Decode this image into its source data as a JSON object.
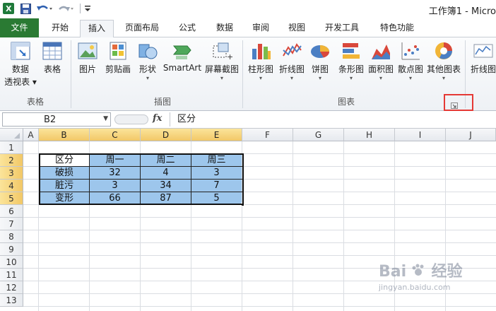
{
  "window": {
    "title": "工作簿1 - Micro"
  },
  "tabs": [
    "文件",
    "开始",
    "插入",
    "页面布局",
    "公式",
    "数据",
    "审阅",
    "视图",
    "开发工具",
    "特色功能"
  ],
  "ribbon": {
    "groups": {
      "tables": "表格",
      "illustrations": "插图",
      "charts": "图表"
    },
    "buttons": {
      "pivot_line1": "数据",
      "pivot_line2": "透视表",
      "table": "表格",
      "picture": "图片",
      "clipart": "剪贴画",
      "shapes": "形状",
      "smartart": "SmartArt",
      "screenshot": "屏幕截图",
      "column": "柱形图",
      "line": "折线图",
      "pie": "饼图",
      "bar": "条形图",
      "area": "面积图",
      "scatter": "散点图",
      "other": "其他图表",
      "sparkline": "折线图"
    }
  },
  "formula_bar": {
    "name_box": "B2",
    "fx": "fx",
    "value": "区分"
  },
  "columns": [
    "A",
    "B",
    "C",
    "D",
    "E",
    "F",
    "G",
    "H",
    "I",
    "J"
  ],
  "rows": [
    "1",
    "2",
    "3",
    "4",
    "5",
    "6",
    "7",
    "8",
    "9",
    "10",
    "11",
    "12",
    "13"
  ],
  "table": {
    "header": [
      "区分",
      "周一",
      "周二",
      "周三"
    ],
    "rows": [
      [
        "破损",
        "32",
        "4",
        "3"
      ],
      [
        "脏污",
        "3",
        "34",
        "7"
      ],
      [
        "变形",
        "66",
        "87",
        "5"
      ]
    ]
  },
  "watermark": {
    "text1": "Bai",
    "text2": "经验",
    "url": "jingyan.baidu.com"
  },
  "colors": {
    "file_tab": "#2a7a33",
    "cell_fill": "#9dc6ec",
    "highlight": "#e53935"
  }
}
